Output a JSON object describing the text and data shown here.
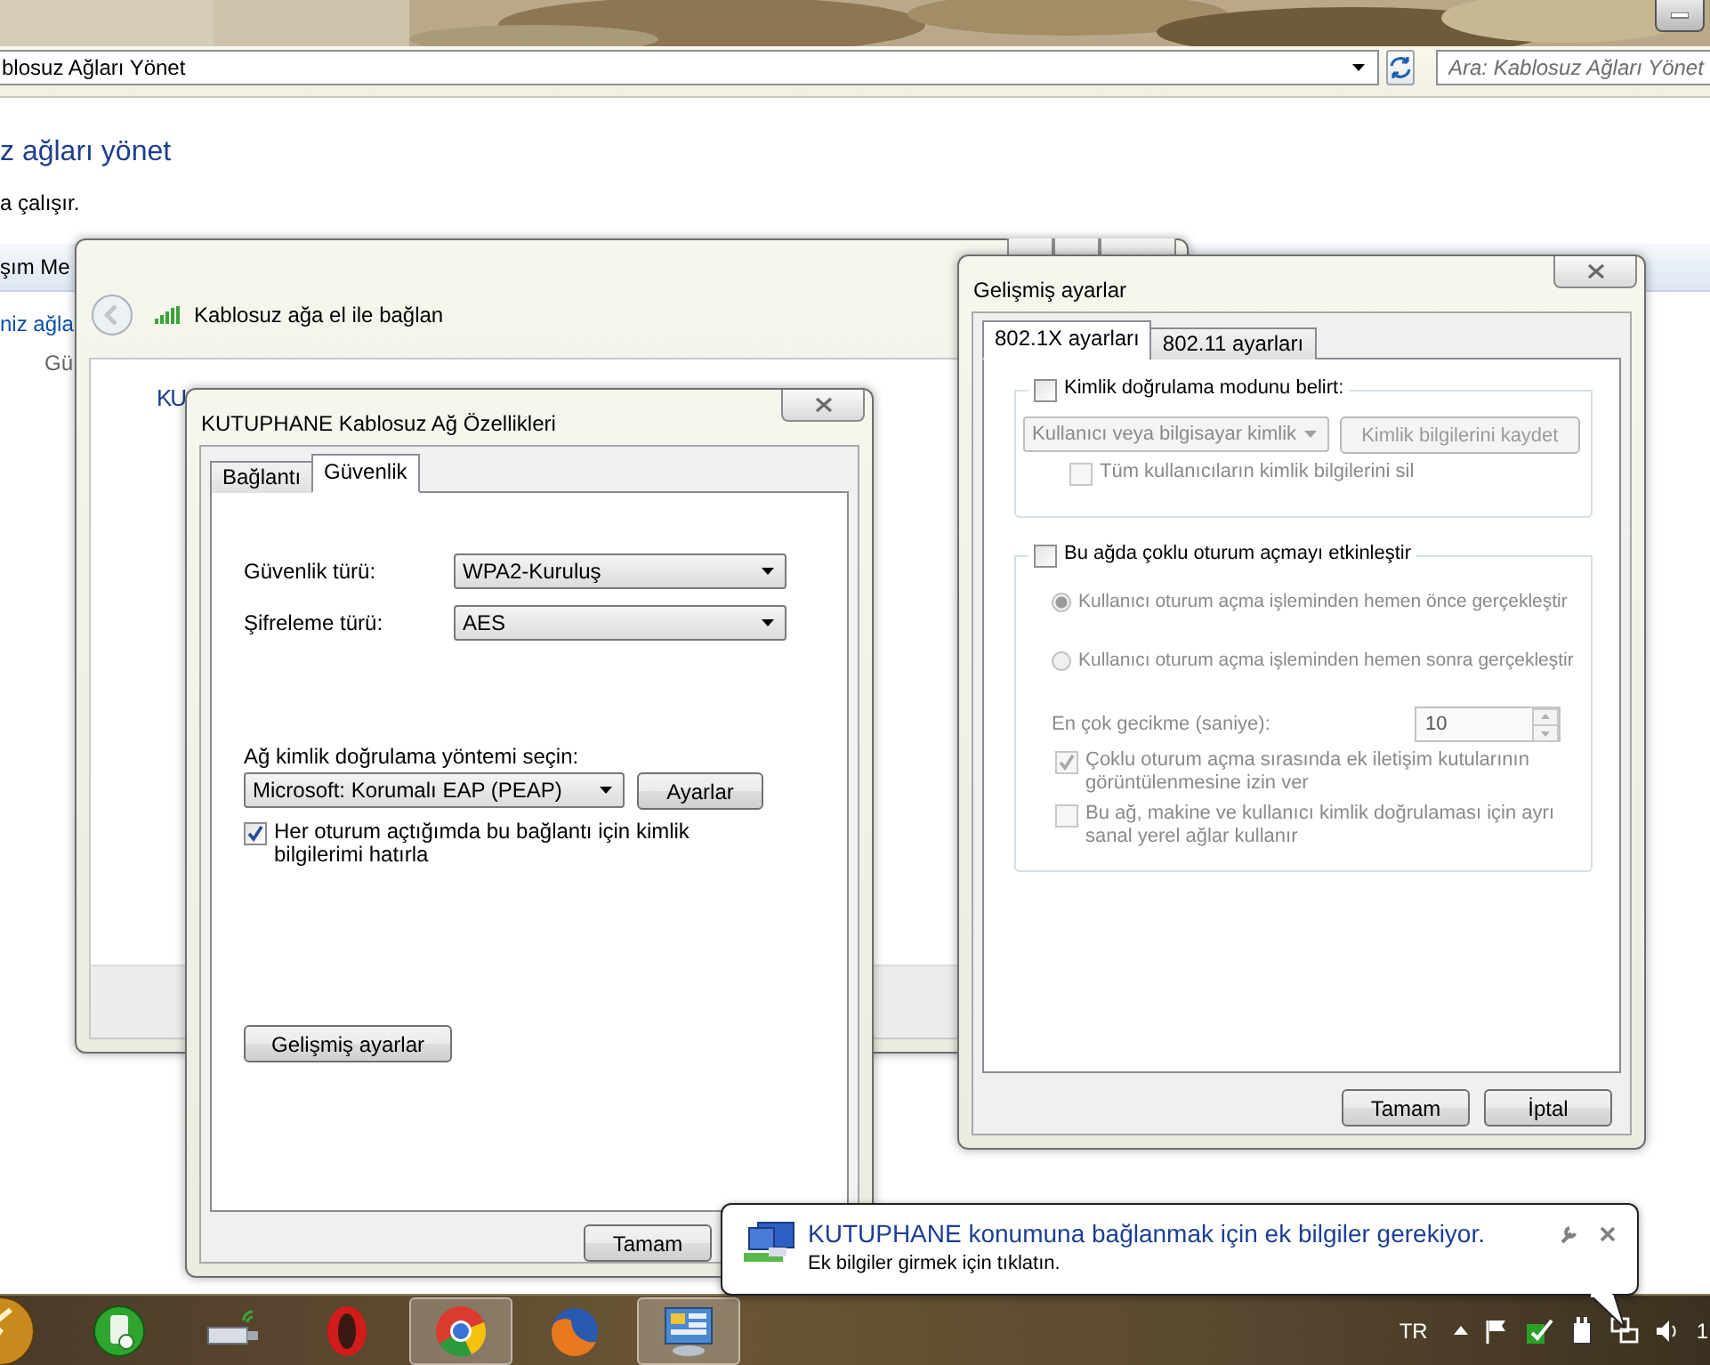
{
  "explorer": {
    "address": "blosuz Ağları Yönet",
    "search_placeholder": "Ara: Kablosuz Ağları Yönet",
    "heading": "z ağları yönet",
    "description": "a çalışır.",
    "toolbar_text": "şım Me",
    "link": "niz ağla",
    "column_text": "Gü"
  },
  "connect_window": {
    "title": "Kablosuz ağa el ile bağlan",
    "body_text": "KU"
  },
  "properties_dialog": {
    "title": "KUTUPHANE Kablosuz Ağ Özellikleri",
    "tabs": [
      {
        "label": "Bağlantı",
        "selected": false
      },
      {
        "label": "Güvenlik",
        "selected": true
      }
    ],
    "security_type": {
      "label": "Güvenlik türü:",
      "value": "WPA2-Kuruluş"
    },
    "encryption_type": {
      "label": "Şifreleme türü:",
      "value": "AES"
    },
    "auth_method": {
      "label": "Ağ kimlik doğrulama yöntemi seçin:",
      "value": "Microsoft: Korumalı EAP (PEAP)"
    },
    "settings_button": "Ayarlar",
    "remember": {
      "label": "Her oturum açtığımda bu bağlantı için kimlik bilgilerimi hatırla",
      "checked": true
    },
    "advanced_button": "Gelişmiş ayarlar",
    "ok_button": "Tamam"
  },
  "advanced_dialog": {
    "title": "Gelişmiş ayarlar",
    "tabs": [
      {
        "label": "802.1X ayarları",
        "selected": true
      },
      {
        "label": "802.11 ayarları",
        "selected": false
      }
    ],
    "auth_mode": {
      "label": "Kimlik doğrulama modunu belirt:",
      "checked": false
    },
    "mode_select": {
      "value": "Kullanıcı veya bilgisayar kimlik",
      "disabled": true
    },
    "save_button": {
      "label": "Kimlik bilgilerini kaydet",
      "disabled": true
    },
    "delete_all": {
      "label": "Tüm kullanıcıların kimlik bilgilerini sil",
      "checked": false,
      "disabled": true
    },
    "sso": {
      "label": "Bu ağda çoklu oturum açmayı etkinleştir",
      "checked": false
    },
    "sso_options": [
      {
        "label": "Kullanıcı oturum açma işleminden hemen önce gerçekleştir",
        "selected": true,
        "disabled": true
      },
      {
        "label": "Kullanıcı oturum açma işleminden hemen sonra gerçekleştir",
        "selected": false,
        "disabled": true
      }
    ],
    "max_delay": {
      "label": "En çok gecikme (saniye):",
      "value": "10",
      "disabled": true
    },
    "sso_checks": [
      {
        "label": "Çoklu oturum açma sırasında ek iletişim kutularının görüntülenmesine izin ver",
        "checked": true,
        "disabled": true
      },
      {
        "label": "Bu ağ, makine ve kullanıcı kimlik doğrulaması için ayrı sanal yerel ağlar kullanır",
        "checked": false,
        "disabled": true
      }
    ],
    "buttons": [
      "Tamam",
      "İptal"
    ]
  },
  "notification": {
    "title": "KUTUPHANE konumuna bağlanmak için ek bilgiler gerekiyor.",
    "message": "Ek bilgiler girmek için tıklatın."
  },
  "taskbar": {
    "apps": [
      {
        "kind": "phone",
        "selected": false
      },
      {
        "kind": "usb",
        "selected": false
      },
      {
        "kind": "opera",
        "selected": false
      },
      {
        "kind": "chrome",
        "selected": true
      },
      {
        "kind": "firefox",
        "selected": false
      },
      {
        "kind": "panel",
        "selected": true
      }
    ],
    "language": "TR",
    "clock": "1"
  }
}
